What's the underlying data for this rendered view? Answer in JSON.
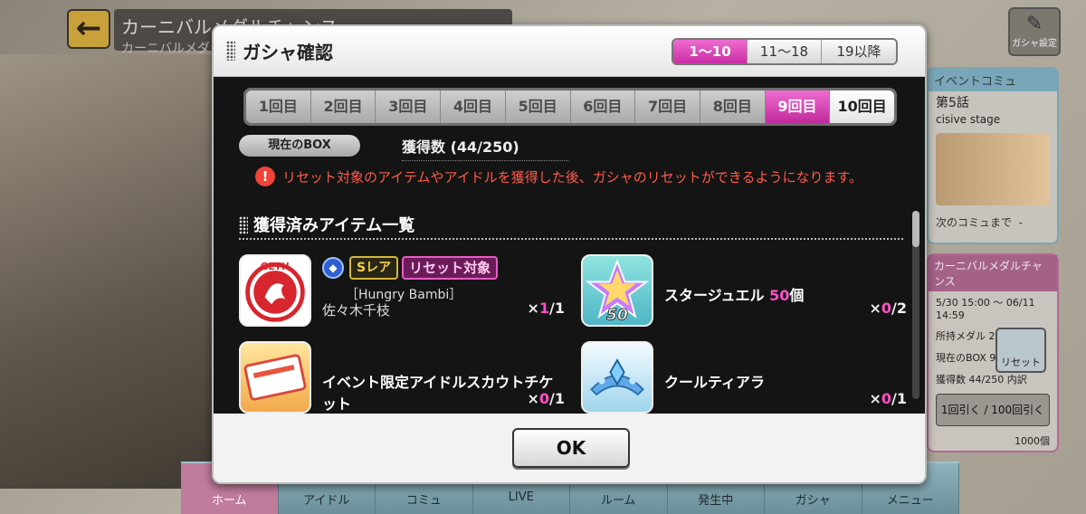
{
  "background": {
    "title": "カーニバルメダルチャンス",
    "subtitle": "カーニバルメダ",
    "settings_label": "ガシャ設定",
    "event_panel": {
      "header": "イベントコミュ",
      "episode": "第5話",
      "episode_sub": "cisive stage",
      "next_label": "次のコミュまで",
      "next_value": "-"
    },
    "carnival_panel": {
      "header": "カーニバルメダルチャンス",
      "period": "5/30 15:00 ～ 06/11 14:59",
      "cost_label": "所持メダル",
      "cost_value": "2個",
      "box_label": "現在のBOX",
      "box_value": "9回目",
      "count_label": "獲得数",
      "count_value": "44/250",
      "detail_button": "内訳",
      "draw1_button": "1回引く",
      "draw100_button": "100回引く",
      "draw100_cost": "1000個"
    },
    "reset_button": "リセット",
    "nav": [
      "ホーム",
      "アイドル",
      "コミュ",
      "LIVE",
      "ルーム",
      "発生中",
      "ガシャ",
      "メニュー"
    ]
  },
  "dialog": {
    "title": "ガシャ確認",
    "range_tabs": [
      "1～10",
      "11～18",
      "19以降"
    ],
    "active_range": "1～10",
    "round_tabs": [
      "1回目",
      "2回目",
      "3回目",
      "4回目",
      "5回目",
      "6回目",
      "7回目",
      "8回目",
      "9回目",
      "10回目"
    ],
    "active_round": "9回目",
    "box_label": "現在のBOX",
    "box_count": "獲得数 (44/250)",
    "notice": "リセット対象のアイテムやアイドルを獲得した後、ガシャのリセットができるようになります。",
    "list_title": "獲得済みアイテム一覧",
    "items": [
      {
        "rarity": "Sレア",
        "reset_tag": "リセット対象",
        "title": "［Hungry Bambi］",
        "name": "佐々木千枝",
        "qty_prefix": "×",
        "qty_have": "1",
        "qty_total": "/1",
        "thumb_text": "GET!!"
      },
      {
        "name": "スタージュエル",
        "name_count": "50",
        "name_unit": "個",
        "qty_prefix": "×",
        "qty_have": "0",
        "qty_total": "/2",
        "thumb_text": "50"
      },
      {
        "name": "イベント限定アイドルスカウトチケット",
        "qty_prefix": "×",
        "qty_have": "0",
        "qty_total": "/1"
      },
      {
        "name": "クールティアラ",
        "qty_prefix": "×",
        "qty_have": "0",
        "qty_total": "/1"
      }
    ],
    "ok_button": "OK"
  },
  "colors": {
    "accent_pink": "#e04cc0",
    "warning_red": "#ff5a4a",
    "body_dark": "#141414"
  }
}
